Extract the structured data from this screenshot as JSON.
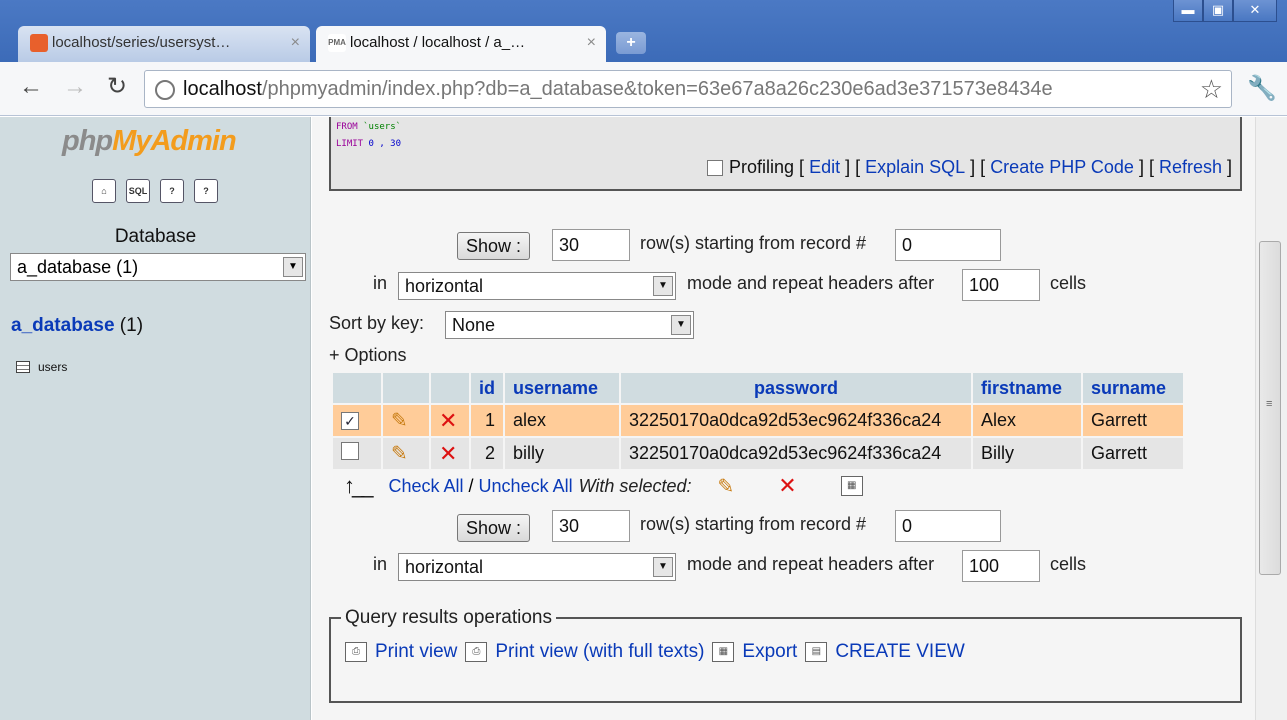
{
  "browser": {
    "tabs": [
      {
        "label": "localhost/series/usersyst…",
        "active": false
      },
      {
        "label": "localhost / localhost / a_…",
        "active": true
      }
    ],
    "favicon_pma": "PMA",
    "url_host": "localhost",
    "url_rest": "/phpmyadmin/index.php?db=a_database&token=63e67a8a26c230e6ad3e371573e8434e",
    "win_minimize": "▬",
    "win_maximize": "▣",
    "win_close": "✕",
    "new_tab": "+",
    "close_tab": "×"
  },
  "left": {
    "logo_php": "php",
    "logo_my": "My",
    "logo_admin": "Admin",
    "icons": [
      {
        "label": "⌂",
        "name": "home-icon"
      },
      {
        "label": "SQL",
        "name": "sql-icon"
      },
      {
        "label": "?",
        "name": "query-icon"
      },
      {
        "label": "?",
        "name": "docs-icon"
      }
    ],
    "database_label": "Database",
    "database_select": "a_database (1)",
    "db_name": "a_database",
    "db_count": " (1)",
    "tables": [
      "users"
    ]
  },
  "sql": {
    "line1_kw": "FROM",
    "line1_str": " `users`",
    "line2_kw": "LIMIT",
    "line2_num": " 0 , 30",
    "profiling": "Profiling",
    "edit": "Edit",
    "explain": "Explain SQL",
    "create_php": "Create PHP Code",
    "refresh": "Refresh"
  },
  "nav_form": {
    "show_label": "Show :",
    "rows_value": "30",
    "rows_text": "row(s) starting from record #",
    "start_value": "0",
    "in_text": "in",
    "mode_value": "horizontal",
    "mode_text": "mode and repeat headers after",
    "headers_value": "100",
    "cells_text": "cells"
  },
  "sort": {
    "label": "Sort by key:",
    "value": "None"
  },
  "options_link": "+ Options",
  "results": {
    "columns": [
      "id",
      "username",
      "password",
      "firstname",
      "surname"
    ],
    "rows": [
      {
        "checked": true,
        "id": "1",
        "username": "alex",
        "password": "32250170a0dca92d53ec9624f336ca24",
        "firstname": "Alex",
        "surname": "Garrett"
      },
      {
        "checked": false,
        "id": "2",
        "username": "billy",
        "password": "32250170a0dca92d53ec9624f336ca24",
        "firstname": "Billy",
        "surname": "Garrett"
      }
    ]
  },
  "selection": {
    "check_all": "Check All",
    "separator": " / ",
    "uncheck_all": "Uncheck All",
    "with_selected": "With selected:"
  },
  "operations": {
    "legend": "Query results operations",
    "print_view": "Print view",
    "print_view_full": "Print view (with full texts)",
    "export": "Export",
    "create_view": "CREATE VIEW"
  },
  "colors": {
    "link": "#0a3ab8",
    "left_frame_bg": "#d0dce0",
    "marked_row": "#ffcc99",
    "odd_row": "#e5e5e5",
    "chrome_blue": "#3c6bb8"
  }
}
